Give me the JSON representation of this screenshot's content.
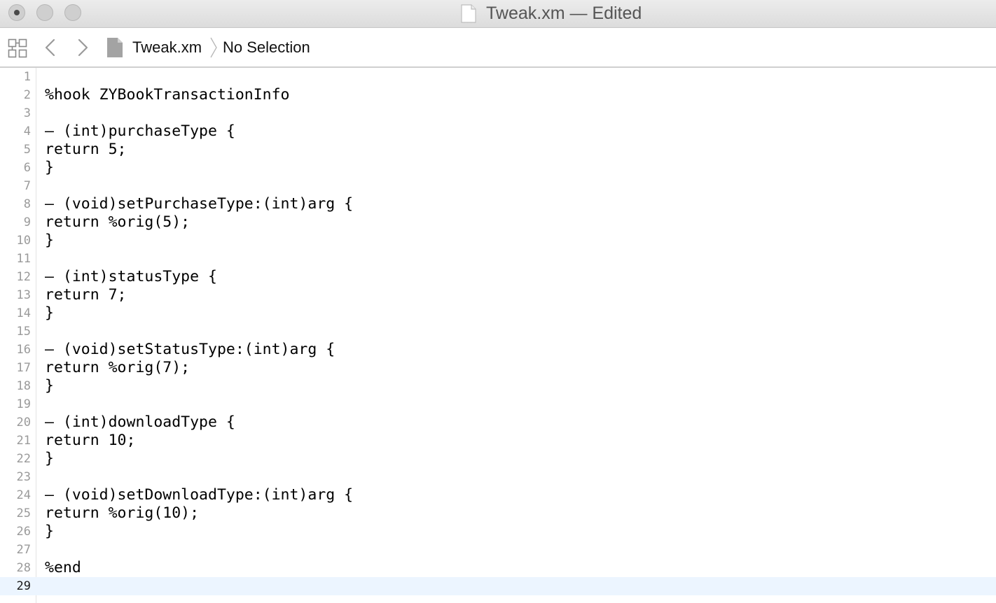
{
  "window": {
    "title": "Tweak.xm — Edited",
    "title_icon": "document-icon"
  },
  "jumpbar": {
    "grid_icon": "related-items-grid-icon",
    "back_icon": "chevron-left-icon",
    "forward_icon": "chevron-right-icon",
    "file_label": "Tweak.xm",
    "file_icon": "document-icon",
    "separator_icon": "chevron-right-icon",
    "selection_label": "No Selection"
  },
  "editor": {
    "current_line": 29,
    "lines": [
      {
        "num": "1",
        "text": ""
      },
      {
        "num": "2",
        "text": "%hook ZYBookTransactionInfo"
      },
      {
        "num": "3",
        "text": ""
      },
      {
        "num": "4",
        "text": "– (int)purchaseType {"
      },
      {
        "num": "5",
        "text": "return 5;"
      },
      {
        "num": "6",
        "text": "}"
      },
      {
        "num": "7",
        "text": ""
      },
      {
        "num": "8",
        "text": "– (void)setPurchaseType:(int)arg {"
      },
      {
        "num": "9",
        "text": "return %orig(5);"
      },
      {
        "num": "10",
        "text": "}"
      },
      {
        "num": "11",
        "text": ""
      },
      {
        "num": "12",
        "text": "– (int)statusType {"
      },
      {
        "num": "13",
        "text": "return 7;"
      },
      {
        "num": "14",
        "text": "}"
      },
      {
        "num": "15",
        "text": ""
      },
      {
        "num": "16",
        "text": "– (void)setStatusType:(int)arg {"
      },
      {
        "num": "17",
        "text": "return %orig(7);"
      },
      {
        "num": "18",
        "text": "}"
      },
      {
        "num": "19",
        "text": ""
      },
      {
        "num": "20",
        "text": "– (int)downloadType {"
      },
      {
        "num": "21",
        "text": "return 10;"
      },
      {
        "num": "22",
        "text": "}"
      },
      {
        "num": "23",
        "text": ""
      },
      {
        "num": "24",
        "text": "– (void)setDownloadType:(int)arg {"
      },
      {
        "num": "25",
        "text": "return %orig(10);"
      },
      {
        "num": "26",
        "text": "}"
      },
      {
        "num": "27",
        "text": ""
      },
      {
        "num": "28",
        "text": "%end"
      },
      {
        "num": "29",
        "text": ""
      }
    ]
  }
}
